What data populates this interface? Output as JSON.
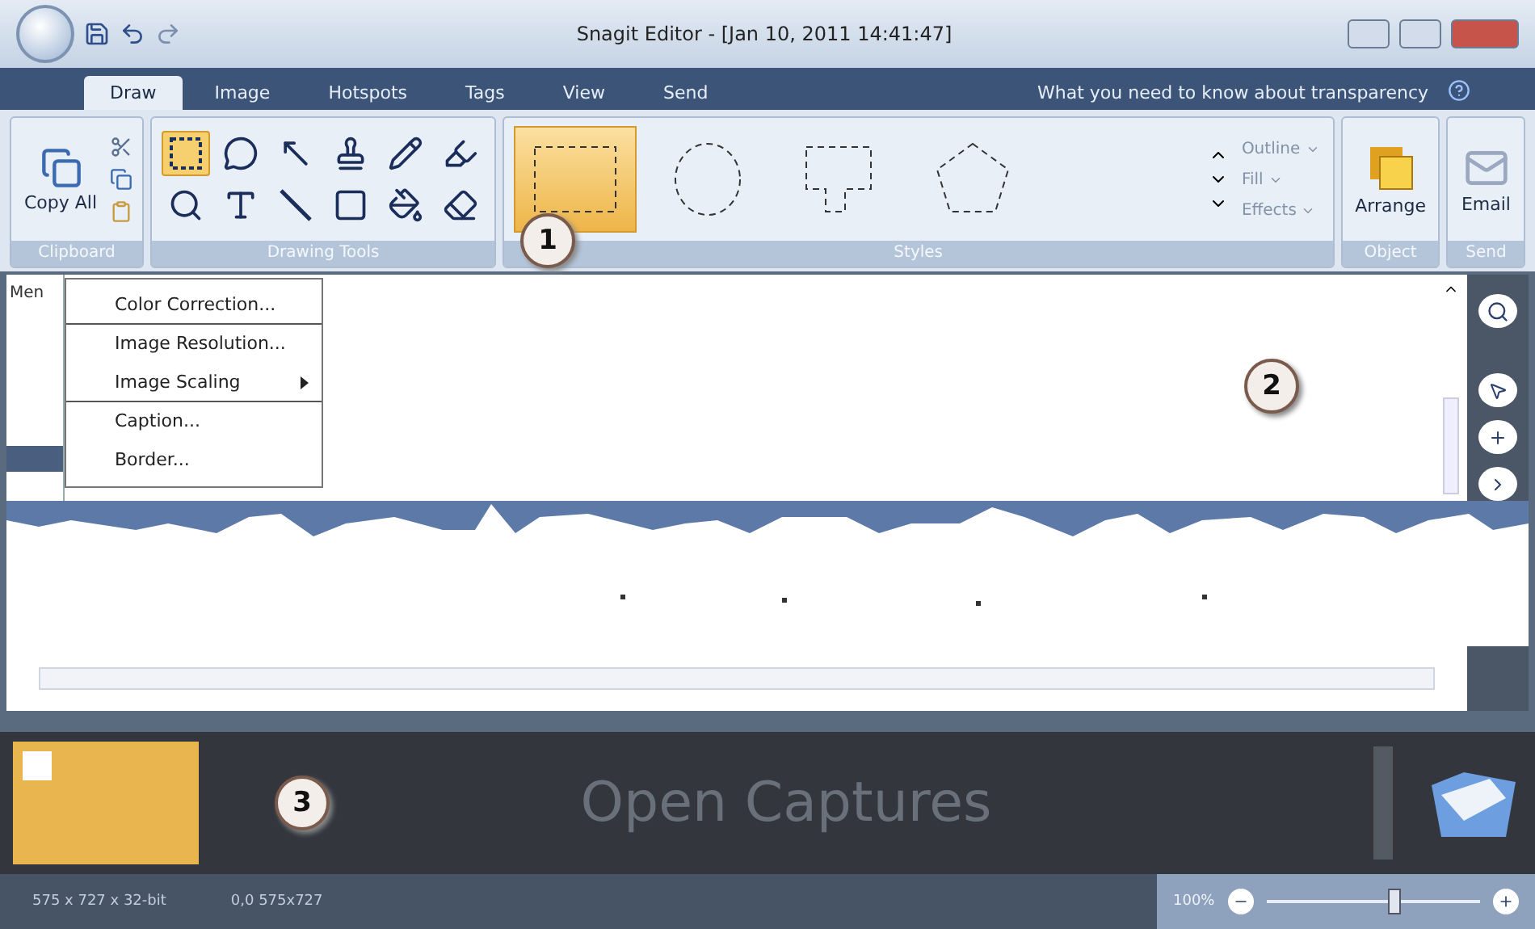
{
  "window": {
    "title": "Snagit Editor - [Jan 10, 2011 14:41:47]"
  },
  "tabs": [
    {
      "label": "Draw",
      "selected": true
    },
    {
      "label": "Image",
      "selected": false
    },
    {
      "label": "Hotspots",
      "selected": false
    },
    {
      "label": "Tags",
      "selected": false
    },
    {
      "label": "View",
      "selected": false
    },
    {
      "label": "Send",
      "selected": false
    }
  ],
  "help_link": "What you need to know about transparency",
  "clipboard": {
    "copy_all": "Copy All",
    "label": "Clipboard"
  },
  "drawing_tools": {
    "label": "Drawing Tools",
    "tools": [
      {
        "kind": "selection",
        "selected": true
      },
      {
        "kind": "callout",
        "selected": false
      },
      {
        "kind": "arrow",
        "selected": false
      },
      {
        "kind": "stamp",
        "selected": false
      },
      {
        "kind": "pen",
        "selected": false
      },
      {
        "kind": "highlighter",
        "selected": false
      },
      {
        "kind": "zoom",
        "selected": false
      },
      {
        "kind": "text",
        "selected": false
      },
      {
        "kind": "line",
        "selected": false
      },
      {
        "kind": "shape",
        "selected": false
      },
      {
        "kind": "fill",
        "selected": false
      },
      {
        "kind": "eraser",
        "selected": false
      }
    ]
  },
  "styles": {
    "label": "Styles",
    "items": [
      {
        "kind": "rect",
        "selected": true
      },
      {
        "kind": "circle",
        "selected": false
      },
      {
        "kind": "callout",
        "selected": false
      },
      {
        "kind": "pentagon",
        "selected": false
      }
    ],
    "options": [
      "Outline",
      "Fill",
      "Effects"
    ]
  },
  "object": {
    "label": "Object",
    "arrange": "Arrange"
  },
  "send": {
    "label": "Send",
    "email": "Email"
  },
  "side_label": "Men",
  "menu": [
    {
      "label": "Color Correction...",
      "submenu": false,
      "separator_after": true
    },
    {
      "label": "Image Resolution...",
      "submenu": false,
      "separator_after": false
    },
    {
      "label": "Image Scaling",
      "submenu": true,
      "separator_after": true
    },
    {
      "label": "Caption...",
      "submenu": false,
      "separator_after": false
    },
    {
      "label": "Border...",
      "submenu": false,
      "separator_after": false
    }
  ],
  "callouts": [
    "1",
    "2",
    "3"
  ],
  "tray": {
    "hint": "Open Captures"
  },
  "status_bar": {
    "dimensions": "575 x 727 x 32-bit",
    "position": "0,0 575x727",
    "zoom": "100%",
    "zoom_slider": {
      "level": 0.6
    }
  }
}
